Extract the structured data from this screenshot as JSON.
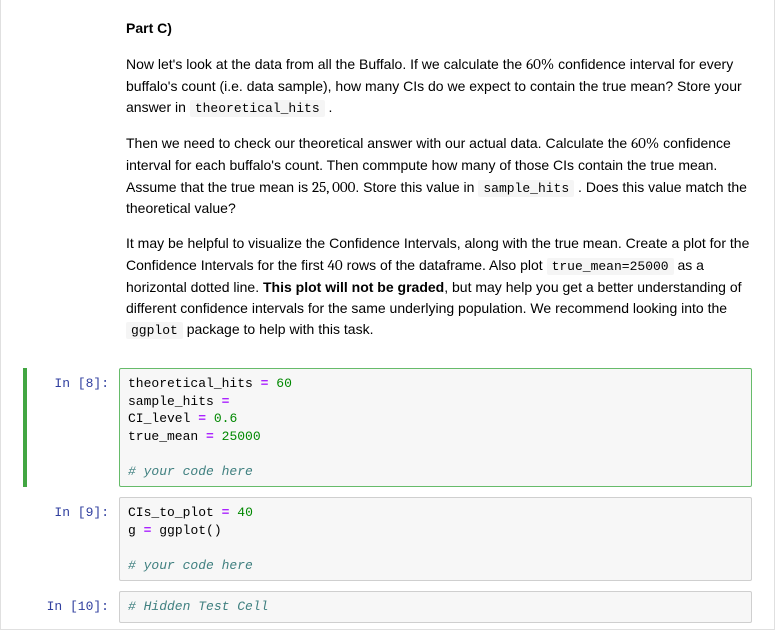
{
  "markdown": {
    "heading": "Part C)",
    "p1_pre": "Now let's look at the data from all the Buffalo. If we calculate the ",
    "p1_ci": "60%",
    "p1_mid": " confidence interval for every buffalo's count (i.e. data sample), how many CIs do we expect to contain the true mean? Store your answer in ",
    "p1_code": "theoretical_hits",
    "p1_post": " .",
    "p2_pre": "Then we need to check our theoretical answer with our actual data. Calculate the ",
    "p2_ci": "60%",
    "p2_mid": " confidence interval for each buffalo's count. Then commpute how many of those CIs contain the true mean. Assume that the true mean is ",
    "p2_mean": "25, 000",
    "p2_mid2": ". Store this value in ",
    "p2_code": "sample_hits",
    "p2_post": " . Does this value match the theoretical value?",
    "p3_pre": "It may be helpful to visualize the Confidence Intervals, along with the true mean. Create a plot for the Confidence Intervals for the first ",
    "p3_num": "40",
    "p3_mid": " rows of the dataframe. Also plot ",
    "p3_code1": "true_mean=25000",
    "p3_mid2": " as a horizontal dotted line. ",
    "p3_bold": "This plot will not be graded",
    "p3_mid3": ", but may help you get a better understanding of different confidence intervals for the same underlying population. We recommend looking into the ",
    "p3_code2": "ggplot",
    "p3_post": " package to help with this task."
  },
  "cells": [
    {
      "prompt": "In [8]:",
      "lines": [
        {
          "type": "assign",
          "name": "theoretical_hits",
          "value": "60"
        },
        {
          "type": "assign_blank",
          "name": "sample_hits"
        },
        {
          "type": "assign",
          "name": "CI_level",
          "value": "0.6"
        },
        {
          "type": "assign",
          "name": "true_mean",
          "value": "25000"
        },
        {
          "type": "blank"
        },
        {
          "type": "comment",
          "text": "# your code here"
        }
      ]
    },
    {
      "prompt": "In [9]:",
      "lines": [
        {
          "type": "assign",
          "name": "CIs_to_plot",
          "value": "40"
        },
        {
          "type": "assign_call",
          "name": "g",
          "call": "ggplot()"
        },
        {
          "type": "blank"
        },
        {
          "type": "comment",
          "text": "# your code here"
        }
      ]
    },
    {
      "prompt": "In [10]:",
      "lines": [
        {
          "type": "comment",
          "text": "# Hidden Test Cell"
        }
      ]
    }
  ]
}
